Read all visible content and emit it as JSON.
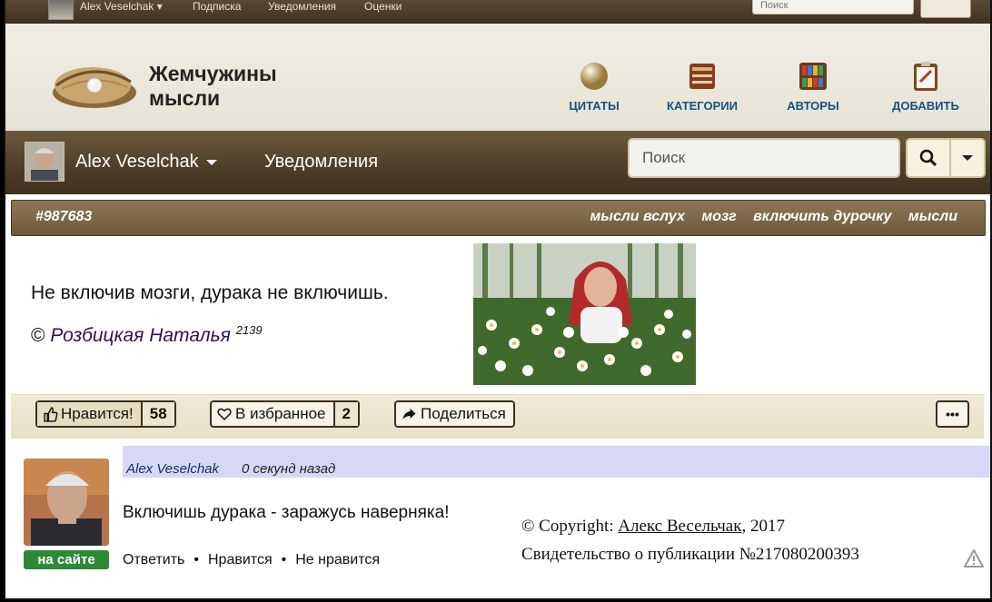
{
  "topbar": {
    "user": "Alex Veselchak",
    "items": [
      "Подписка",
      "Уведомления",
      "Оценки"
    ],
    "search_placeholder": "Поиск"
  },
  "header": {
    "site_title_line1": "Жемчужины",
    "site_title_line2": "мысли",
    "nav": [
      {
        "label": "ЦИТАТЫ",
        "icon": "pearl-icon"
      },
      {
        "label": "КАТЕГОРИИ",
        "icon": "book-icon"
      },
      {
        "label": "АВТОРЫ",
        "icon": "bookshelf-icon"
      },
      {
        "label": "ДОБАВИТЬ",
        "icon": "clipboard-icon"
      }
    ]
  },
  "userbar": {
    "user": "Alex Veselchak",
    "notifications": "Уведомления",
    "search_placeholder": "Поиск"
  },
  "quote": {
    "id": "#987683",
    "tags": [
      "мысли вслух",
      "мозг",
      "включить дурочку",
      "мысли"
    ],
    "text": "Не включив мозги, дурака не включишь.",
    "copyright_sign": "©",
    "author": "Розбицкая Наталья",
    "author_count": "2139"
  },
  "actions": {
    "like_label": "Нравится!",
    "like_count": "58",
    "fav_label": "В избранное",
    "fav_count": "2",
    "share_label": "Поделиться",
    "more": "•••"
  },
  "comment": {
    "author": "Alex Veselchak",
    "time": "0 секунд назад",
    "text": "Включишь дурака - заражусь наверняка!",
    "status": "на сайте",
    "links": [
      "Ответить",
      "Нравится",
      "Не нравится"
    ]
  },
  "copyright": {
    "prefix": "© Copyright: ",
    "name": "Алекс Весельчак",
    "year": ", 2017",
    "certificate": "Свидетельство о публикации №217080200393"
  },
  "colors": {
    "brown_bar": "#4c3d28",
    "nav_blue": "#16527a",
    "online_green": "#2c8a35",
    "comment_header": "#d6d8f6",
    "author_purple": "#3b0c55"
  }
}
